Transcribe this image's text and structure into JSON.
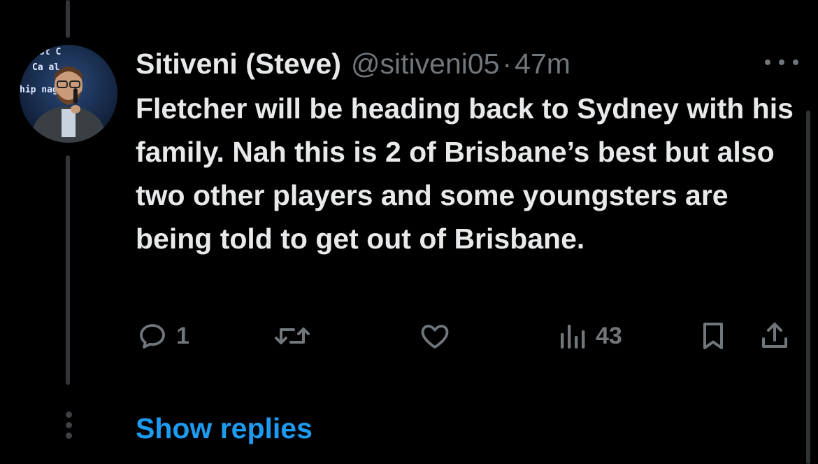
{
  "tweet": {
    "display_name": "Sitiveni (Steve)",
    "handle": "@sitiveni05",
    "separator": "·",
    "time": "47m",
    "text": "Fletcher will be heading back to Sydney with his family. Nah this is 2 of Brisbane’s best but also two other players and some youngsters are being told to get out of Brisbane.",
    "avatar_icon": "profile-photo-speaker-with-microphone"
  },
  "actions": {
    "reply_count": "1",
    "retweet_count": "",
    "like_count": "",
    "views_count": "43"
  },
  "show_replies_label": "Show replies",
  "colors": {
    "background": "#000000",
    "primary_text": "#e7e9ea",
    "secondary_text": "#71767b",
    "link": "#1d9bf0",
    "thread_line": "#333639"
  }
}
